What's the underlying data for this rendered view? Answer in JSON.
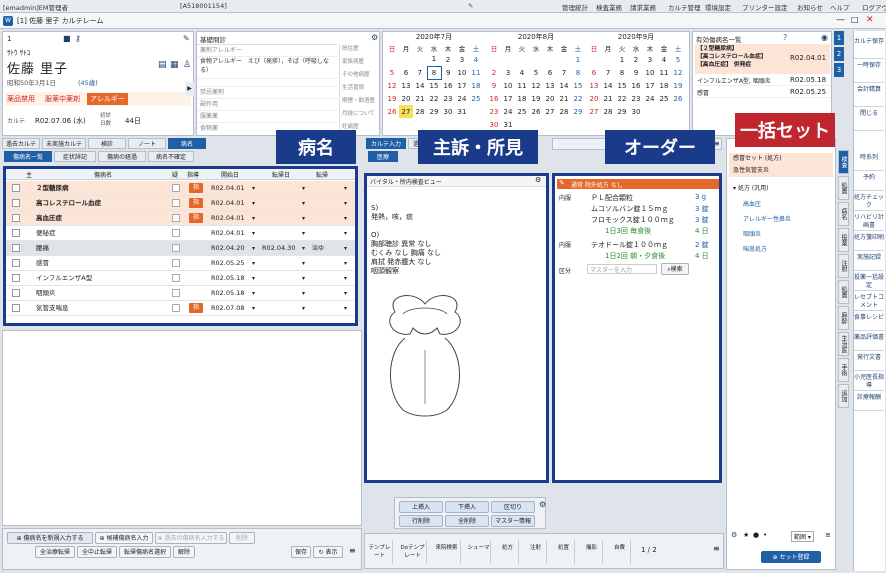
{
  "topbar": {
    "session": "[emadmin]EM管理者",
    "patient_id": "[A518001154]",
    "menus": [
      "管理統計",
      "検査業務",
      "請求業務",
      "カルテ管理",
      "環境設定",
      "プリンター設定",
      "お知らせ",
      "ヘルプ",
      "ログアウト"
    ]
  },
  "titlebar": {
    "title": "[1] 佐藤 里子 カルテレーム"
  },
  "patient": {
    "no": "1",
    "kana": "ｻﾄｳ ｻﾄｺ",
    "name": "佐藤 里子",
    "birth": "昭和50年3月1日",
    "age": "(45歳)",
    "allergy_tags": [
      "薬品禁用",
      "服薬中薬剤",
      "アレルギー"
    ],
    "karte_label": "カルテ",
    "karte_date": "R02.07.06 (水)",
    "visit_label1": "初診",
    "visit_label2": "日数",
    "visit_days": "44日"
  },
  "basic_info": {
    "title": "基礎問診",
    "rows": [
      "薬剤アレルギー",
      "食物アレルギー　えび（発疹），そば（呼吸しなる）",
      "",
      "禁忌薬剤",
      "副作用",
      "服薬薬",
      "食物薬"
    ],
    "side": [
      "既往歴",
      "家族病歴",
      "その他病歴",
      "生活習慣",
      "喫煙・飲酒歴",
      "月経について",
      "妊娠歴"
    ]
  },
  "left_tabs": [
    "過去カルテ",
    "未実施カルテ",
    "検診",
    "ノート",
    "病名"
  ],
  "dx_subtabs": [
    "傷病名一覧",
    "症状詳記",
    "傷病の経過",
    "病名不確定"
  ],
  "dx_headers": [
    "主",
    "傷病名",
    "疑",
    "指導",
    "開始日",
    "転帰日",
    "転帰"
  ],
  "dx_rows": [
    {
      "name": "２型糖尿病",
      "start": "R02.04.01",
      "end": "",
      "outcome": "",
      "hl": true,
      "bold": true,
      "badge": "指"
    },
    {
      "name": "高コレステロール血症",
      "start": "R02.04.01",
      "end": "",
      "outcome": "",
      "hl": true,
      "bold": true,
      "badge": "指"
    },
    {
      "name": "高血圧症",
      "start": "R02.04.01",
      "end": "",
      "outcome": "",
      "hl": true,
      "bold": true,
      "badge": "指"
    },
    {
      "name": "便秘症",
      "start": "R02.04.01",
      "end": "",
      "outcome": "",
      "hl": false,
      "bold": false,
      "badge": ""
    },
    {
      "name": "腰痛",
      "start": "R02.04.20",
      "end": "R02.04.30",
      "outcome": "治ゆ",
      "hl": false,
      "bold": false,
      "badge": "",
      "gray": true
    },
    {
      "name": "感冒",
      "start": "R02.05.25",
      "end": "",
      "outcome": "",
      "hl": false,
      "bold": false,
      "badge": ""
    },
    {
      "name": "インフルエンザA型",
      "start": "R02.05.18",
      "end": "",
      "outcome": "",
      "hl": false,
      "bold": false,
      "badge": ""
    },
    {
      "name": "咽頭炎",
      "start": "R02.05.18",
      "end": "",
      "outcome": "",
      "hl": false,
      "bold": false,
      "badge": ""
    },
    {
      "name": "気管支喘息",
      "start": "R02.07.08",
      "end": "",
      "outcome": "",
      "hl": false,
      "bold": false,
      "badge": "指"
    }
  ],
  "dx_bottom": {
    "buttons1": [
      "傷病名を新規入力する",
      "候補傷病名入力",
      "過去の傷病名入力する",
      "削除"
    ],
    "buttons2": [
      "全治療転帰",
      "全中止転帰",
      "転帰傷病名選択",
      "解除"
    ],
    "save": "保存",
    "display": "表示"
  },
  "calendar": {
    "months": [
      {
        "title": "2020年7月",
        "days": [
          [
            "",
            "",
            "",
            "1",
            "2",
            "3",
            "4"
          ],
          [
            "5",
            "6",
            "7",
            "8",
            "9",
            "10",
            "11"
          ],
          [
            "12",
            "13",
            "14",
            "15",
            "16",
            "17",
            "18"
          ],
          [
            "19",
            "20",
            "21",
            "22",
            "23",
            "24",
            "25"
          ],
          [
            "26",
            "27",
            "28",
            "29",
            "30",
            "31",
            ""
          ]
        ]
      },
      {
        "title": "2020年8月",
        "days": [
          [
            "",
            "",
            "",
            "",
            "",
            "",
            "1"
          ],
          [
            "2",
            "3",
            "4",
            "5",
            "6",
            "7",
            "8"
          ],
          [
            "9",
            "10",
            "11",
            "12",
            "13",
            "14",
            "15"
          ],
          [
            "16",
            "17",
            "18",
            "19",
            "20",
            "21",
            "22"
          ],
          [
            "23",
            "24",
            "25",
            "26",
            "27",
            "28",
            "29"
          ],
          [
            "30",
            "31",
            "",
            "",
            "",
            "",
            ""
          ]
        ]
      },
      {
        "title": "2020年9月",
        "days": [
          [
            "",
            "",
            "1",
            "2",
            "3",
            "4",
            "5"
          ],
          [
            "6",
            "7",
            "8",
            "9",
            "10",
            "11",
            "12"
          ],
          [
            "13",
            "14",
            "15",
            "16",
            "17",
            "18",
            "19"
          ],
          [
            "20",
            "21",
            "22",
            "23",
            "24",
            "25",
            "26"
          ],
          [
            "27",
            "28",
            "29",
            "30",
            "",
            "",
            ""
          ]
        ]
      }
    ],
    "weekdays": [
      "日",
      "月",
      "火",
      "水",
      "木",
      "金",
      "土"
    ]
  },
  "active_dx": {
    "title": "有効傷病名一覧",
    "rows": [
      {
        "name": "【２型糖尿病】\n【高コレステロール血症】\n【高血圧症】 併発症",
        "date": "R02.04.01"
      },
      {
        "name": "インフルエンザA型, 咽頭炎",
        "date": "R02.05.18"
      },
      {
        "name": "感冒",
        "date": "R02.05.25"
      }
    ]
  },
  "soap": {
    "tabs": [
      "カルテ入力",
      "過去カルテ"
    ],
    "subtab": "医療",
    "header": "バイタル・所内検査ビュー",
    "text": [
      "S)",
      "発熱，咳，痰",
      "",
      "O)",
      "胸部聴診 異常 なし",
      "むくみ なし 胸痛 なし",
      "肩拭 発赤腫大 なし",
      "咽頭観察"
    ],
    "buttons": [
      "上挿入",
      "下挿入",
      "区切り",
      "行削除",
      "全削除",
      "マスター情報"
    ]
  },
  "order": {
    "header": "処方 院外処方",
    "sub": "通常 院外処方 なし",
    "label1": "内服",
    "item1": "ＰＬ配合顆粒",
    "qty1": "3 g",
    "item2": "ムコソルバン錠１５ｍｇ",
    "qty2": "3 錠",
    "item3": "フロモックス錠１００ｍｇ",
    "qty3": "3 錠",
    "dose1": "1日3回 毎食後",
    "days1": "4 日",
    "label2": "内服",
    "item4": "テオドール錠１００ｍｇ",
    "qty4": "2 錠",
    "dose2": "1日2回 朝・夕食後",
    "days2": "4 日",
    "kubun": "区分",
    "master": "マスターを入力",
    "search": "検索"
  },
  "order_tabs": [
    "テンプレート",
    "Doテンプレート",
    "来院検索",
    "シューマ",
    "処方",
    "注射",
    "処置",
    "撮影",
    "自費"
  ],
  "page": "1 / 2",
  "bulk": {
    "items": [
      "感冒セット (処方)",
      "急性気管支炎"
    ],
    "section": "処方 (汎用)",
    "list": [
      "高血圧",
      "アレルギー性鼻炎",
      "咽頭炎",
      "喘息処方"
    ],
    "btn": "セット登録",
    "view": "範囲"
  },
  "side_nav": [
    "カルテ保存",
    "一時保存",
    "会計精算",
    "閉じる",
    "",
    "時系列",
    "予約",
    "処方チェック",
    "リハビリ計画書",
    "処方箋印刷",
    "実施記録",
    "投薬一括設定",
    "レセプトコメント",
    "食事レシピ",
    "薬品評価書",
    "発行文書",
    "小児医長指導",
    "診療報酬"
  ],
  "vtabs": [
    "検査",
    "処置",
    "病名",
    "投薬",
    "注射",
    "処置",
    "麻酔",
    "主治医",
    "手術",
    "追加"
  ],
  "callouts": {
    "byomei": "病名",
    "shuso": "主訴・所見",
    "order": "オーダー",
    "bulk": "一括セット"
  }
}
